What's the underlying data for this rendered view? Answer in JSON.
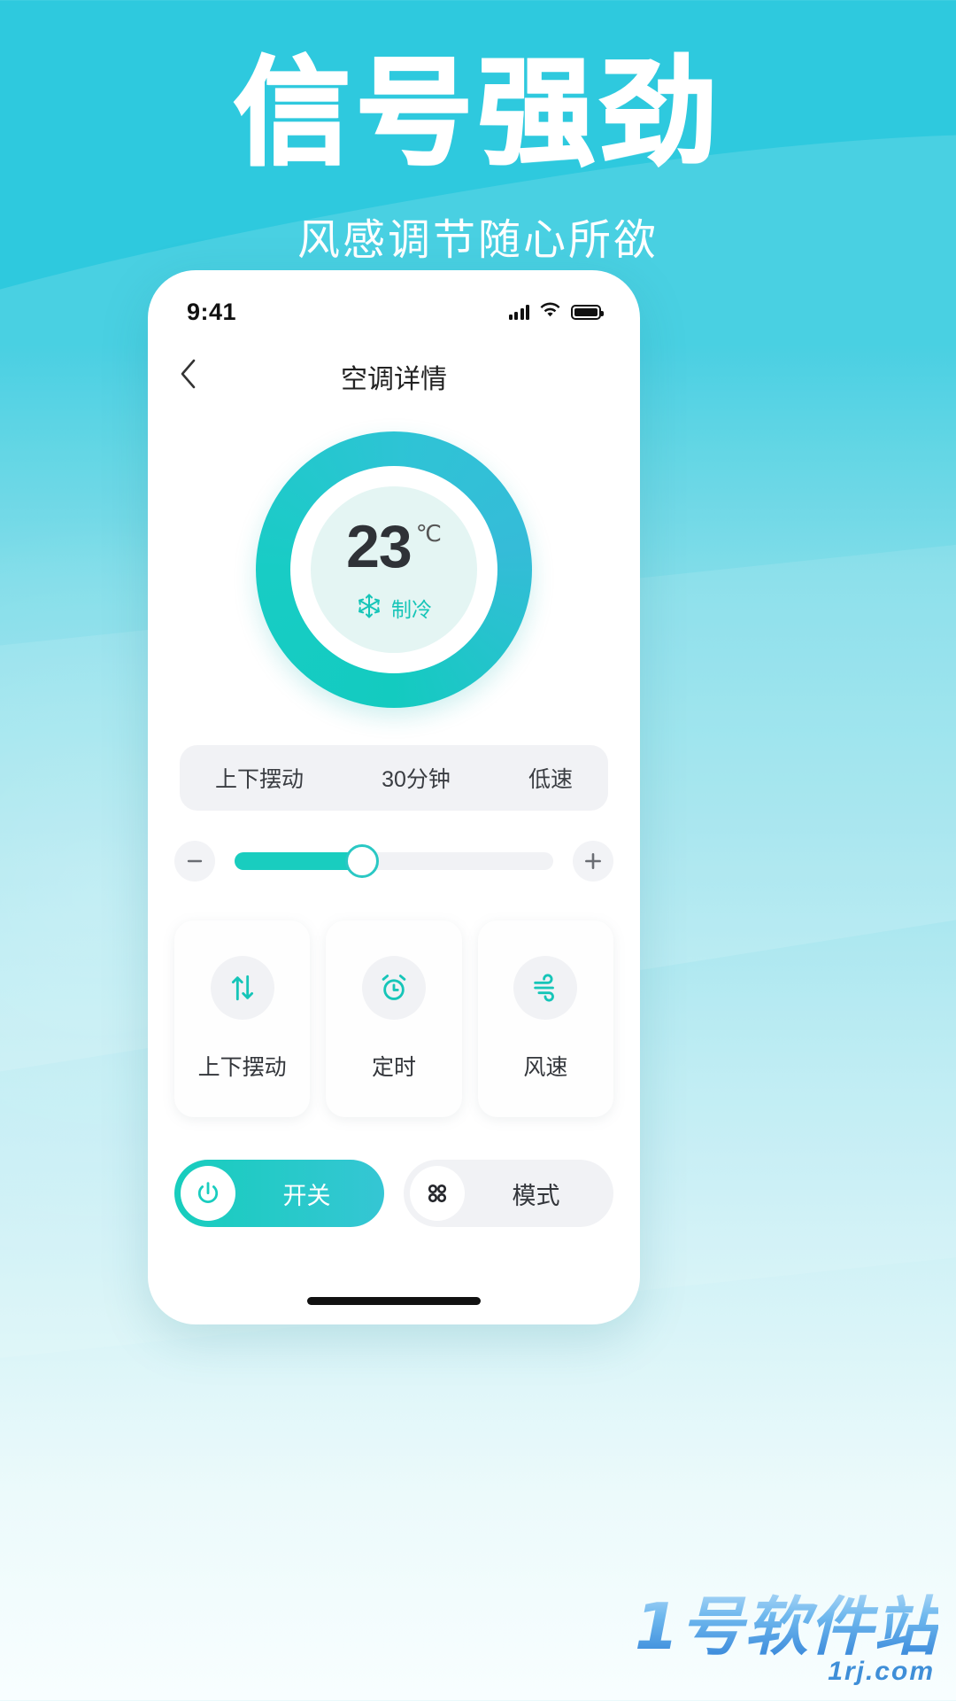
{
  "hero": {
    "title": "信号强劲",
    "subtitle": "风感调节随心所欲"
  },
  "colors": {
    "bg_top": "#2ec9de",
    "bg_bottom": "#f8feff",
    "accent": "#19cdbf",
    "accent_alt": "#35c6d4",
    "dial_core": "#e4f5f3",
    "track": "#f1f2f5"
  },
  "phone": {
    "statusbar": {
      "time": "9:41",
      "signal_icon": "cellular-signal-icon",
      "wifi_icon": "wifi-icon",
      "battery_icon": "battery-full-icon"
    },
    "navbar": {
      "back_icon": "chevron-left-icon",
      "title": "空调详情"
    },
    "dial": {
      "temperature": "23",
      "unit": "℃",
      "mode_icon": "snowflake-icon",
      "mode_label": "制冷",
      "ring_progress_pct": 100
    },
    "status_pill": {
      "swing": "上下摆动",
      "timer": "30分钟",
      "fan_speed": "低速"
    },
    "slider": {
      "decrease_label": "−",
      "increase_label": "+",
      "value_pct": 40
    },
    "cards": [
      {
        "icon": "up-down-arrows-icon",
        "label": "上下摆动"
      },
      {
        "icon": "alarm-clock-icon",
        "label": "定时"
      },
      {
        "icon": "wind-icon",
        "label": "风速"
      }
    ],
    "actions": [
      {
        "icon": "power-icon",
        "label": "开关",
        "active": true
      },
      {
        "icon": "grid-dots-icon",
        "label": "模式",
        "active": false
      }
    ]
  },
  "watermark": {
    "name": "1号软件站",
    "domain": "1rj.com"
  }
}
